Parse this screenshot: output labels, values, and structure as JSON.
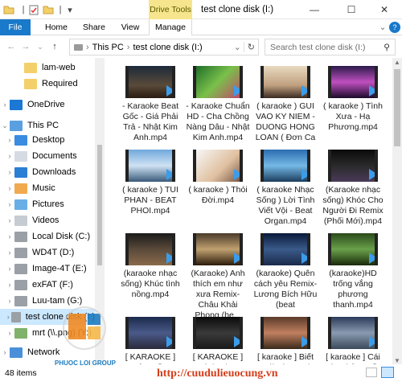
{
  "titlebar": {
    "context_tab": "Drive Tools",
    "window_title": "test clone disk (I:)"
  },
  "ribbon": {
    "tabs": [
      "File",
      "Home",
      "Share",
      "View",
      "Manage"
    ]
  },
  "address": {
    "crumbs": [
      "This PC",
      "test clone disk (I:)"
    ],
    "search_placeholder": "Search test clone disk (I:)"
  },
  "nav": {
    "items": [
      {
        "label": "lam-web",
        "icon": "folder-icon"
      },
      {
        "label": "Required",
        "icon": "folder-icon"
      },
      {
        "label": "OneDrive",
        "icon": "cloud-icon"
      },
      {
        "label": "This PC",
        "icon": "computer-icon"
      },
      {
        "label": "Desktop",
        "icon": "desktop-icon"
      },
      {
        "label": "Documents",
        "icon": "documents-icon"
      },
      {
        "label": "Downloads",
        "icon": "downloads-icon"
      },
      {
        "label": "Music",
        "icon": "music-icon"
      },
      {
        "label": "Pictures",
        "icon": "pictures-icon"
      },
      {
        "label": "Videos",
        "icon": "videos-icon"
      },
      {
        "label": "Local Disk (C:)",
        "icon": "drive-icon"
      },
      {
        "label": "WD4T (D:)",
        "icon": "drive-icon"
      },
      {
        "label": "Image-4T (E:)",
        "icon": "drive-icon"
      },
      {
        "label": "exFAT (F:)",
        "icon": "drive-icon"
      },
      {
        "label": "Luu-tam (G:)",
        "icon": "drive-icon"
      },
      {
        "label": "test clone disk (I:)",
        "icon": "drive-icon"
      },
      {
        "label": "mrt (\\\\.png) (Y:)",
        "icon": "network-drive-icon"
      },
      {
        "label": "Network",
        "icon": "network-icon"
      }
    ]
  },
  "files": [
    {
      "name": "- Karaoke Beat Gốc - Giá Phải Trả - Nhật Kim Anh.mp4"
    },
    {
      "name": "- Karaoke Chuẩn HD - Cha Chồng Nàng Dâu - Nhật Kim Anh.mp4"
    },
    {
      "name": "( karaoke ) GUI VAO KY NIEM - DUONG HONG LOAN ( Đơn Ca"
    },
    {
      "name": "( karaoke ) Tình Xưa - Hạ Phương.mp4"
    },
    {
      "name": "( karaoke ) TUI PHAN - BEAT PHOI.mp4"
    },
    {
      "name": "( karaoke ) Thói Đời.mp4"
    },
    {
      "name": "( karaoke Nhạc Sống ) Lời Tình Viết Vội - Beat Organ.mp4"
    },
    {
      "name": "(Karaoke nhạc sống) Khóc Cho Người Đi Remix (Phối Mới).mp4"
    },
    {
      "name": "(karaoke nhạc sống) Khúc tình nồng.mp4"
    },
    {
      "name": "(Karaoke) Anh thích em như xưa Remix- Châu Khải Phong (be..."
    },
    {
      "name": "(karaoke) Quên cách yêu Remix-Lương Bích Hữu (beat"
    },
    {
      "name": "(karaoke)HD trống vắng phương thanh.mp4"
    },
    {
      "name": "[ KARAOKE ] Tâm Hồn"
    },
    {
      "name": "[ KARAOKE ] Tình Như"
    },
    {
      "name": "[ karaoke ] Biết Nói Gì Hơn ("
    },
    {
      "name": "[ karaoke ] Cái Xác Không Hồn"
    }
  ],
  "status": {
    "count": "48 items"
  },
  "watermark": {
    "url": "http://cuudulieuocung.vn",
    "logo_text": "PHUOC LOI GROUP"
  }
}
